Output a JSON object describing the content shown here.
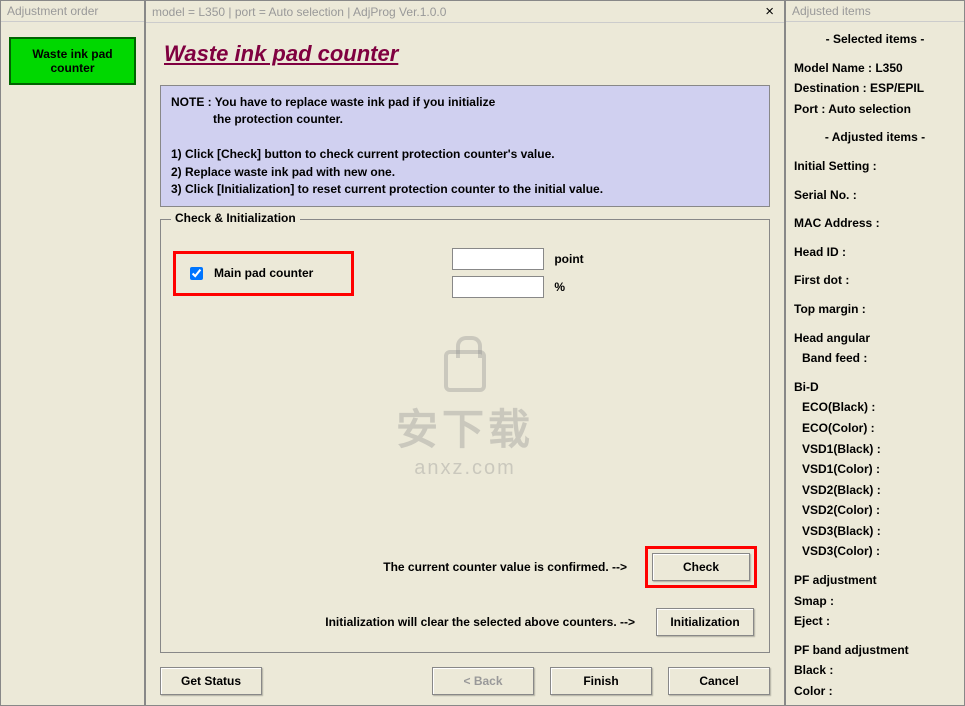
{
  "left_panel": {
    "title": "Adjustment order",
    "button_line1": "Waste ink pad",
    "button_line2": "counter"
  },
  "center": {
    "title_bar": "model = L350 | port = Auto selection | AdjProg Ver.1.0.0",
    "close_label": "×",
    "heading": "Waste ink pad counter",
    "note": {
      "line1": "NOTE : You have to replace waste ink pad if you initialize",
      "line2": "the protection counter.",
      "step1": "1) Click [Check] button to check current protection counter's value.",
      "step2": "2) Replace waste ink pad with new one.",
      "step3": "3) Click [Initialization] to reset current protection counter to the initial value."
    },
    "fieldset_legend": "Check & Initialization",
    "main_pad_label": "Main pad counter",
    "main_pad_checked": true,
    "point_value": "",
    "point_unit": "point",
    "percent_value": "",
    "percent_unit": "%",
    "confirm_text": "The current counter value is confirmed. -->",
    "check_btn": "Check",
    "init_text": "Initialization will clear the selected above counters. -->",
    "init_btn": "Initialization",
    "bottom": {
      "get_status": "Get Status",
      "back": "< Back",
      "finish": "Finish",
      "cancel": "Cancel"
    },
    "watermark": {
      "big": "安下载",
      "small": "anxz.com"
    }
  },
  "right_panel": {
    "title": "Adjusted items",
    "selected_header": "- Selected items -",
    "model": "Model Name : L350",
    "destination": "Destination : ESP/EPIL",
    "port": "Port : Auto selection",
    "adjusted_header": "- Adjusted items -",
    "items": [
      "Initial Setting :",
      "Serial No. :",
      "MAC Address :",
      "Head ID :",
      "First dot :",
      "Top margin :"
    ],
    "head_angular": "Head angular",
    "band_feed": " Band feed :",
    "bid": "Bi-D",
    "bid_items": [
      "ECO(Black)  :",
      "ECO(Color)  :",
      "VSD1(Black) :",
      "VSD1(Color) :",
      "VSD2(Black) :",
      "VSD2(Color) :",
      "VSD3(Black) :",
      "VSD3(Color) :"
    ],
    "pf_adjustment": "PF adjustment",
    "smap": "Smap :",
    "eject": "Eject :",
    "pf_band": "PF band adjustment",
    "black": "Black :",
    "color": "Color :"
  }
}
